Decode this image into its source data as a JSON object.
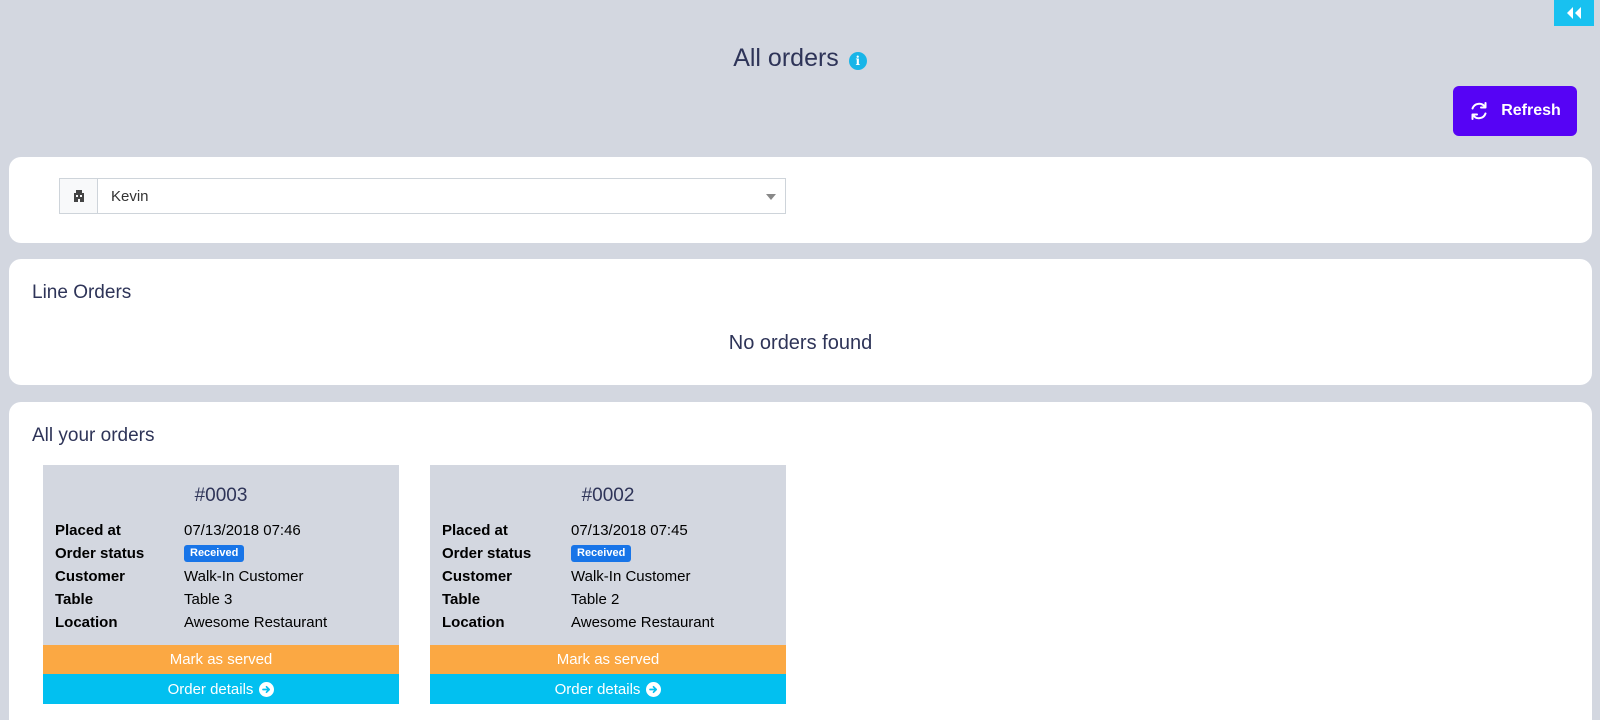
{
  "header": {
    "title": "All orders",
    "refresh_label": "Refresh"
  },
  "filter": {
    "selected_value": "Kevin"
  },
  "line_orders": {
    "heading": "Line Orders",
    "empty_message": "No orders found"
  },
  "all_orders": {
    "heading": "All your orders",
    "orders": [
      {
        "number": "#0003",
        "placed_at_label": "Placed at",
        "placed_at": "07/13/2018 07:46",
        "status_label": "Order status",
        "status": "Received",
        "customer_label": "Customer",
        "customer": "Walk-In Customer",
        "table_label": "Table",
        "table": "Table 3",
        "location_label": "Location",
        "location": "Awesome Restaurant",
        "served_label": "Mark as served",
        "details_label": "Order details"
      },
      {
        "number": "#0002",
        "placed_at_label": "Placed at",
        "placed_at": "07/13/2018 07:45",
        "status_label": "Order status",
        "status": "Received",
        "customer_label": "Customer",
        "customer": "Walk-In Customer",
        "table_label": "Table",
        "table": "Table 2",
        "location_label": "Location",
        "location": "Awesome Restaurant",
        "served_label": "Mark as served",
        "details_label": "Order details"
      }
    ]
  },
  "icons": {
    "collapse": "double-chevron-left-icon",
    "info": "info-icon",
    "refresh": "refresh-icon",
    "filter_addon": "building-icon",
    "select_caret": "caret-down-icon",
    "details_arrow": "arrow-circle-right-icon"
  },
  "colors": {
    "background": "#d3d7e0",
    "accent": "#5603f5",
    "cyan": "#02c0f0",
    "orange": "#fba843",
    "badge": "#1875e8",
    "text": "#2e3458"
  }
}
